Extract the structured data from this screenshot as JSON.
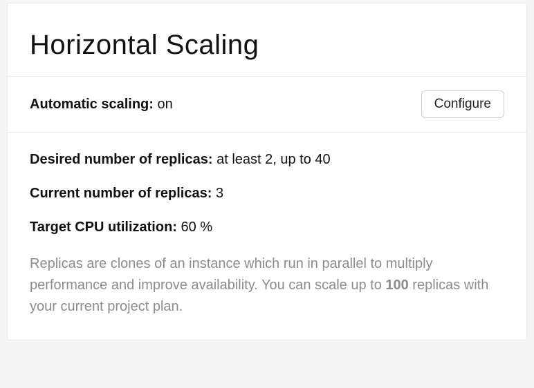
{
  "title": "Horizontal Scaling",
  "status": {
    "label": "Automatic scaling:",
    "value": "on",
    "configure_label": "Configure"
  },
  "details": {
    "desired": {
      "label": "Desired number of replicas:",
      "value": "at least 2, up to 40"
    },
    "current": {
      "label": "Current number of replicas:",
      "value": "3"
    },
    "target_cpu": {
      "label": "Target CPU utilization:",
      "value": "60 %"
    }
  },
  "description": {
    "prefix": "Replicas are clones of an instance which run in parallel to multiply performance and improve availability. You can scale up to ",
    "limit": "100",
    "suffix": " replicas with your current project plan."
  }
}
